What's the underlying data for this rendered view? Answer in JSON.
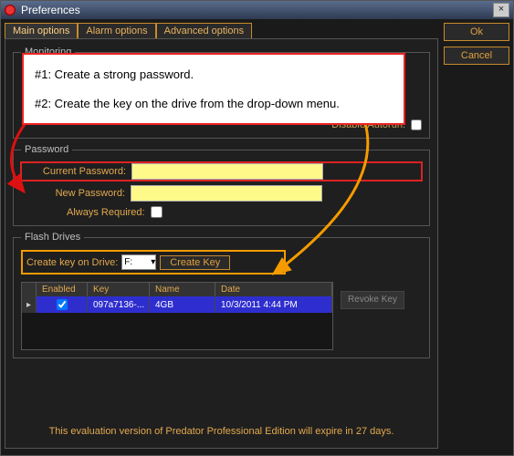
{
  "window": {
    "title": "Preferences"
  },
  "buttons": {
    "ok": "Ok",
    "cancel": "Cancel"
  },
  "tabs": {
    "main": "Main options",
    "alarm": "Alarm options",
    "advanced": "Advanced options"
  },
  "instructions": {
    "line1": "#1: Create a strong password.",
    "line2": "#2: Create the key on the drive from the drop-down menu."
  },
  "monitoring": {
    "legend": "Monitoring",
    "disable_autorun": "Disable Autorun:"
  },
  "password": {
    "legend": "Password",
    "current_label": "Current Password:",
    "current_value": "",
    "new_label": "New Password:",
    "new_value": "",
    "always_required": "Always Required:"
  },
  "flash": {
    "legend": "Flash Drives",
    "create_label": "Create key on Drive:",
    "drive_value": "F:",
    "create_key_btn": "Create Key",
    "revoke_key_btn": "Revoke Key",
    "columns": {
      "enabled": "Enabled",
      "key": "Key",
      "name": "Name",
      "date": "Date"
    },
    "rows": [
      {
        "enabled": true,
        "key": "097a7136-...",
        "name": "4GB",
        "date": "10/3/2011 4:44 PM"
      }
    ]
  },
  "footer": "This evaluation version of Predator Professional Edition will expire in 27 days."
}
